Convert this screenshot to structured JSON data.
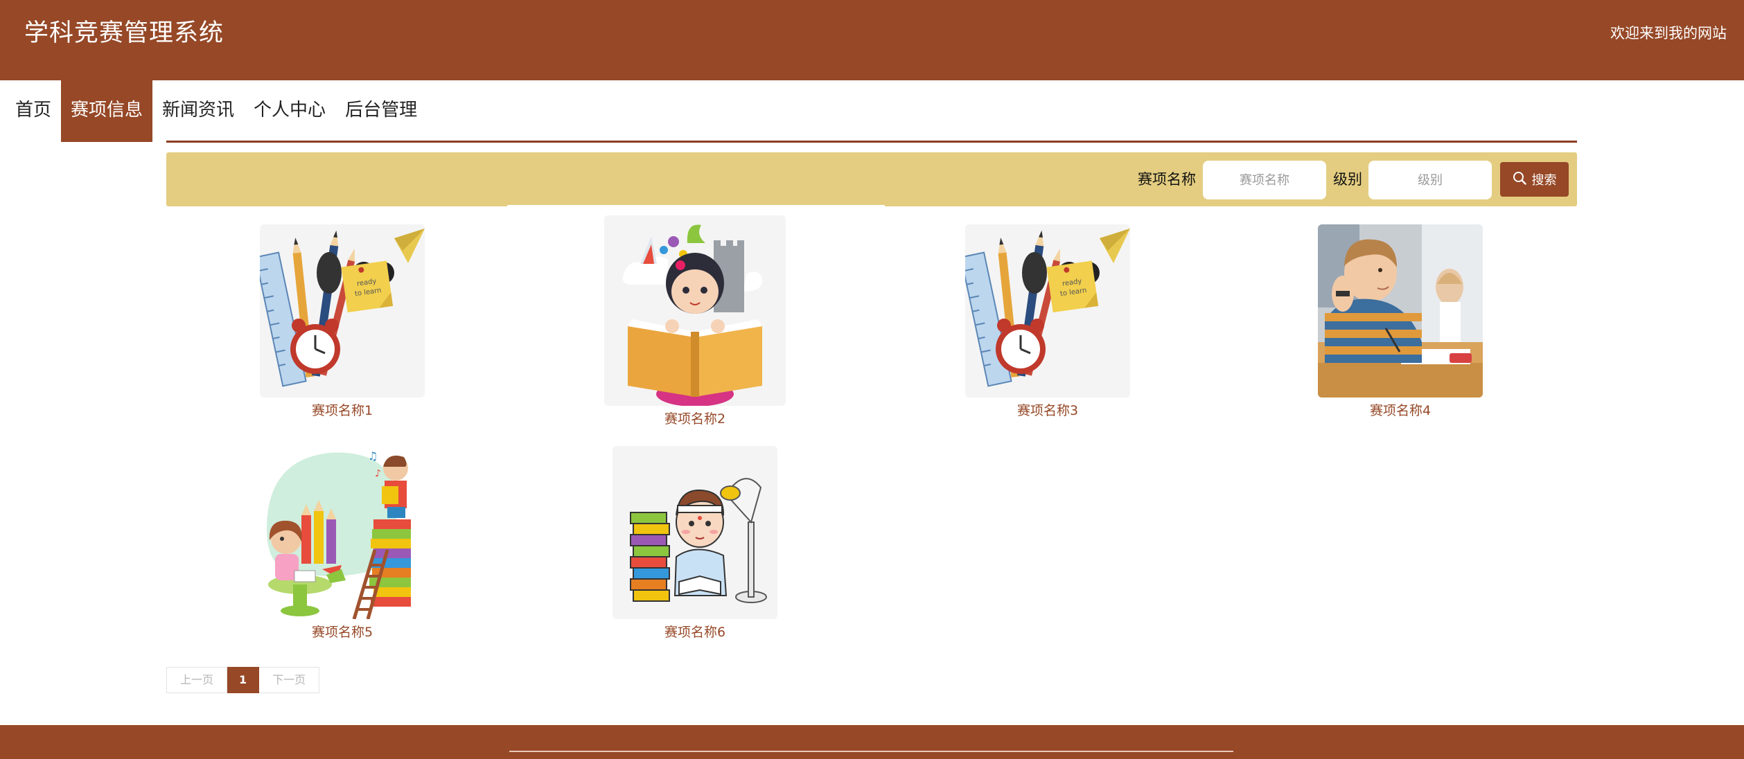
{
  "header": {
    "site_title": "学科竞赛管理系统",
    "welcome": "欢迎来到我的网站"
  },
  "nav": [
    {
      "label": "首页"
    },
    {
      "label": "赛项信息",
      "active": true
    },
    {
      "label": "新闻资讯"
    },
    {
      "label": "个人中心"
    },
    {
      "label": "后台管理"
    }
  ],
  "search": {
    "name_label": "赛项名称",
    "name_placeholder": "赛项名称",
    "name_value": "",
    "level_label": "级别",
    "level_placeholder": "级别",
    "level_value": "",
    "button_label": "搜索",
    "button_icon": "search-icon"
  },
  "cards": [
    {
      "title": "赛项名称1",
      "image": "school-supplies-illustration"
    },
    {
      "title": "赛项名称2",
      "image": "girl-reading-book-illustration"
    },
    {
      "title": "赛项名称3",
      "image": "school-supplies-illustration"
    },
    {
      "title": "赛项名称4",
      "image": "boy-at-desk-photo"
    },
    {
      "title": "赛项名称5",
      "image": "children-reading-illustration"
    },
    {
      "title": "赛项名称6",
      "image": "boy-studying-with-lamp-illustration"
    }
  ],
  "pagination": {
    "prev_label": "上一页",
    "current_page": "1",
    "next_label": "下一页"
  },
  "colors": {
    "brand": "#964827",
    "search_bar": "#e4cd81",
    "card_title": "#964827"
  }
}
